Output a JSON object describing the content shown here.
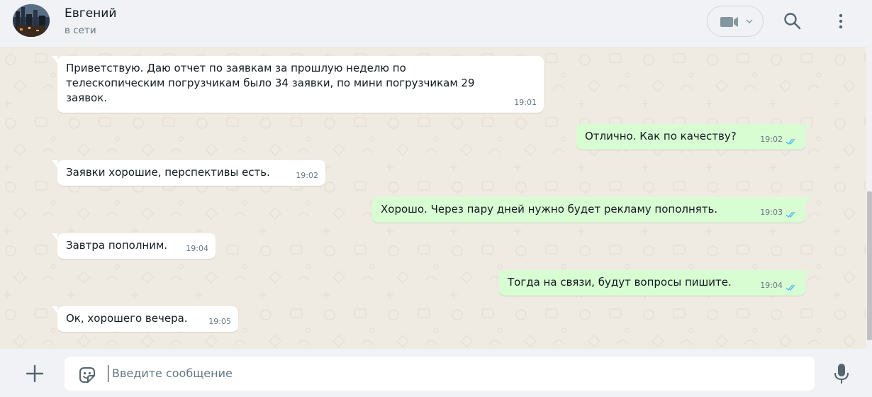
{
  "contact": {
    "name": "Евгений",
    "status": "в сети"
  },
  "header_icons": {
    "video": "video-camera-icon",
    "dropdown": "chevron-down-icon",
    "search": "search-icon",
    "menu": "menu-dots-icon"
  },
  "messages": [
    {
      "direction": "in",
      "lines": [
        "Приветствую. Даю отчет по заявкам за прошлую неделю по",
        "телескопическим погрузчикам было 34 заявки, по мини погрузчикам 29",
        "заявок."
      ],
      "time": "19:01"
    },
    {
      "direction": "out",
      "lines": [
        "Отлично. Как по качеству?"
      ],
      "time": "19:02",
      "status": "read"
    },
    {
      "direction": "in",
      "lines": [
        "Заявки хорошие, перспективы есть."
      ],
      "time": "19:02"
    },
    {
      "direction": "out",
      "lines": [
        "Хорошо. Через пару дней нужно будет рекламу пополнять."
      ],
      "time": "19:03",
      "status": "read"
    },
    {
      "direction": "in",
      "lines": [
        "Завтра пополним."
      ],
      "time": "19:04"
    },
    {
      "direction": "out",
      "lines": [
        "Тогда на связи, будут вопросы пишите."
      ],
      "time": "19:04",
      "status": "read"
    },
    {
      "direction": "in",
      "lines": [
        "Ок, хорошего вечера."
      ],
      "time": "19:05"
    }
  ],
  "composer": {
    "placeholder": "Введите сообщение"
  },
  "colors": {
    "header_bg": "#f0f2f5",
    "chat_bg": "#efeae2",
    "incoming_bubble": "#ffffff",
    "outgoing_bubble": "#d9fdd3",
    "read_ticks": "#53bdeb",
    "icon": "#54656f"
  }
}
